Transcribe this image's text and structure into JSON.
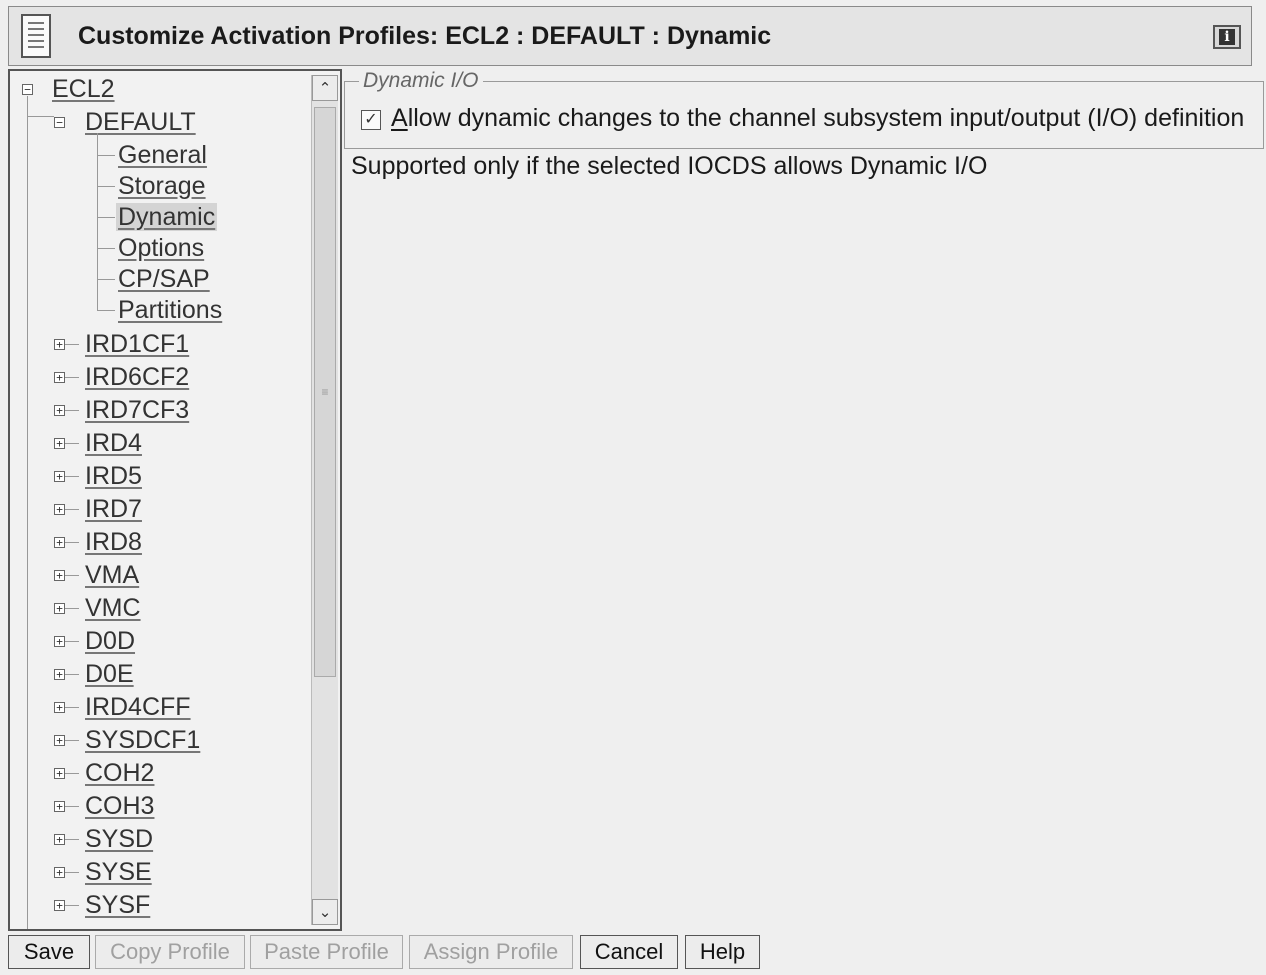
{
  "window": {
    "title": "Customize Activation Profiles: ECL2 : DEFAULT : Dynamic",
    "info_icon": "info-icon"
  },
  "tree": {
    "root": {
      "label": "ECL2",
      "expander": "⊟"
    },
    "default": {
      "label": "DEFAULT",
      "expander": "⊟"
    },
    "children": [
      {
        "label": "General"
      },
      {
        "label": "Storage"
      },
      {
        "label": "Dynamic"
      },
      {
        "label": "Options"
      },
      {
        "label": "CP/SAP"
      },
      {
        "label": "Partitions"
      }
    ],
    "selected": "Dynamic",
    "collapsed_nodes": [
      {
        "label": "IRD1CF1"
      },
      {
        "label": "IRD6CF2"
      },
      {
        "label": "IRD7CF3"
      },
      {
        "label": "IRD4"
      },
      {
        "label": "IRD5"
      },
      {
        "label": "IRD7"
      },
      {
        "label": "IRD8"
      },
      {
        "label": "VMA"
      },
      {
        "label": "VMC"
      },
      {
        "label": "D0D"
      },
      {
        "label": "D0E"
      },
      {
        "label": "IRD4CFF"
      },
      {
        "label": "SYSDCF1"
      },
      {
        "label": "COH2"
      },
      {
        "label": "COH3"
      },
      {
        "label": "SYSD"
      },
      {
        "label": "SYSE"
      },
      {
        "label": "SYSF"
      }
    ],
    "expander_collapsed": "⊞"
  },
  "dynamic_io": {
    "legend": "Dynamic I/O",
    "checkbox_checked": true,
    "checkbox_mnemonic": "A",
    "checkbox_label_rest": "llow dynamic changes to the channel subsystem input/output (I/O) definition",
    "note": "Supported only if the selected IOCDS allows Dynamic I/O"
  },
  "buttons": {
    "save": "Save",
    "copy_profile": "Copy Profile",
    "paste_profile": "Paste Profile",
    "assign_profile": "Assign Profile",
    "cancel": "Cancel",
    "help": "Help"
  },
  "colors": {
    "background": "#efefef",
    "text": "#1a1a1a",
    "disabled_text": "#a0a0a0"
  }
}
